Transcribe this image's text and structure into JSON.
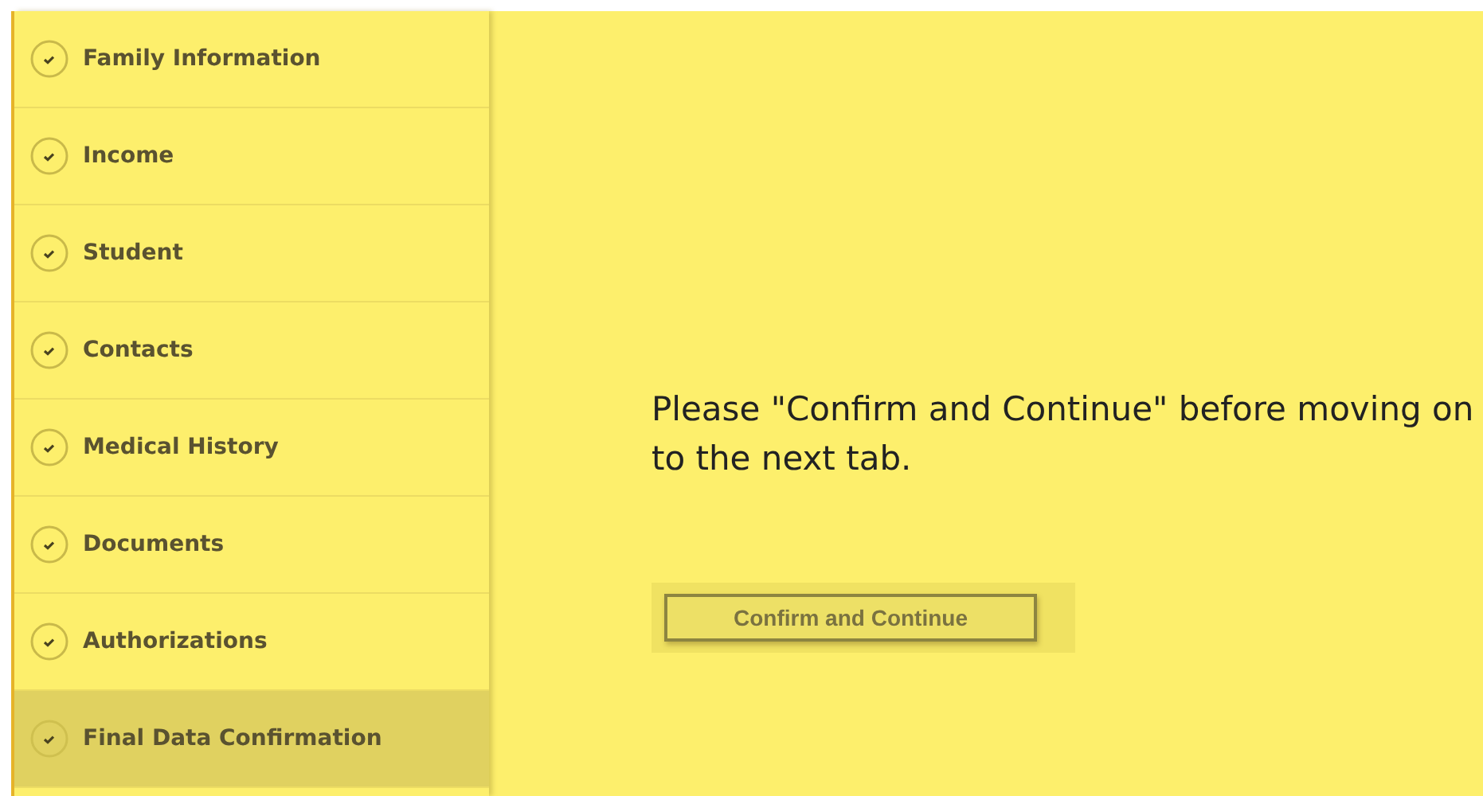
{
  "sidebar": {
    "items": [
      {
        "label": "Family Information",
        "selected": false
      },
      {
        "label": "Income",
        "selected": false
      },
      {
        "label": "Student",
        "selected": false
      },
      {
        "label": "Contacts",
        "selected": false
      },
      {
        "label": "Medical History",
        "selected": false
      },
      {
        "label": "Documents",
        "selected": false
      },
      {
        "label": "Authorizations",
        "selected": false
      },
      {
        "label": "Final Data Confirmation",
        "selected": true
      }
    ]
  },
  "message": "Please \"Confirm and Continue\" before moving on to the next tab.",
  "button": "Confirm and Continue"
}
